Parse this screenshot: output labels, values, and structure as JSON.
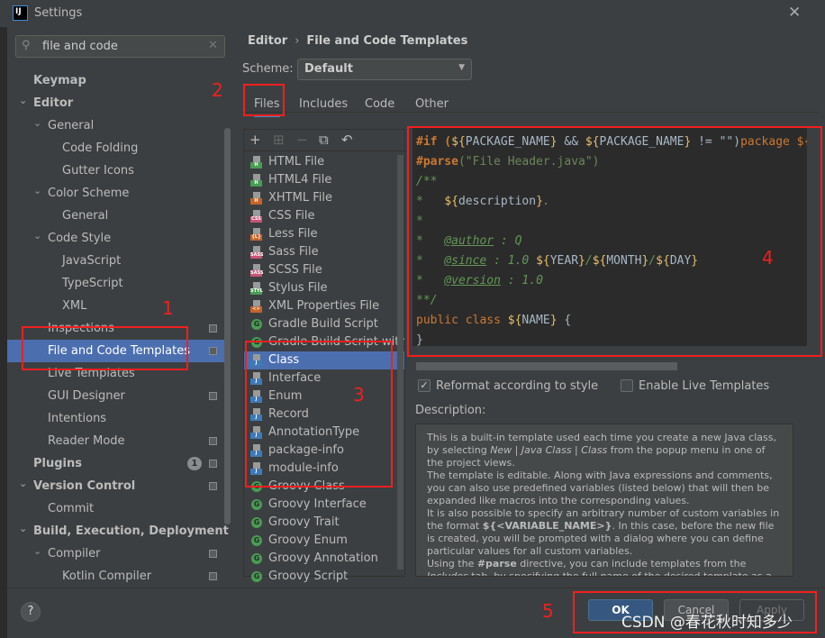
{
  "window": {
    "title": "Settings",
    "logo": "IJ",
    "close_icon": "close-icon"
  },
  "sidebar": {
    "search_value": "file and code",
    "items": [
      {
        "label": "Keymap",
        "level": 0,
        "bold": true
      },
      {
        "label": "Editor",
        "level": 0,
        "bold": true,
        "expanded": true
      },
      {
        "label": "General",
        "level": 1,
        "expanded": true
      },
      {
        "label": "Code Folding",
        "level": 2
      },
      {
        "label": "Gutter Icons",
        "level": 2
      },
      {
        "label": "Color Scheme",
        "level": 1,
        "expanded": true
      },
      {
        "label": "General",
        "level": 2
      },
      {
        "label": "Code Style",
        "level": 1,
        "expanded": true
      },
      {
        "label": "JavaScript",
        "level": 2
      },
      {
        "label": "TypeScript",
        "level": 2
      },
      {
        "label": "XML",
        "level": 2
      },
      {
        "label": "Inspections",
        "level": 1,
        "gear": true
      },
      {
        "label": "File and Code Templates",
        "level": 1,
        "selected": true,
        "gear": true
      },
      {
        "label": "Live Templates",
        "level": 1
      },
      {
        "label": "GUI Designer",
        "level": 1,
        "gear": true
      },
      {
        "label": "Intentions",
        "level": 1
      },
      {
        "label": "Reader Mode",
        "level": 1,
        "gear": true
      },
      {
        "label": "Plugins",
        "level": 0,
        "bold": true,
        "badge": "1",
        "gear": true
      },
      {
        "label": "Version Control",
        "level": 0,
        "bold": true,
        "expanded": true,
        "gear": true
      },
      {
        "label": "Commit",
        "level": 1
      },
      {
        "label": "Build, Execution, Deployment",
        "level": 0,
        "bold": true,
        "expanded": true
      },
      {
        "label": "Compiler",
        "level": 1,
        "expanded": true,
        "gear": true
      },
      {
        "label": "Kotlin Compiler",
        "level": 2,
        "gear": true
      }
    ]
  },
  "main": {
    "breadcrumb": [
      "Editor",
      "File and Code Templates"
    ],
    "scheme_label": "Scheme:",
    "scheme_value": "Default",
    "tabs": [
      {
        "label": "Files",
        "active": true
      },
      {
        "label": "Includes"
      },
      {
        "label": "Code"
      },
      {
        "label": "Other"
      }
    ],
    "templates": [
      {
        "label": "HTML File",
        "icon": "H",
        "color": "#499c54"
      },
      {
        "label": "HTML4 File",
        "icon": "H",
        "color": "#499c54"
      },
      {
        "label": "XHTML File",
        "icon": "H",
        "color": "#c5642a"
      },
      {
        "label": "CSS File",
        "icon": "CSS",
        "color": "#c75476"
      },
      {
        "label": "Less File",
        "icon": "{L}",
        "color": "#c5642a"
      },
      {
        "label": "Sass File",
        "icon": "SASS",
        "color": "#c75476"
      },
      {
        "label": "SCSS File",
        "icon": "SASS",
        "color": "#c75476"
      },
      {
        "label": "Stylus File",
        "icon": "STYL",
        "color": "#499c54"
      },
      {
        "label": "XML Properties File",
        "icon": "<>",
        "color": "#c5642a"
      },
      {
        "label": "Gradle Build Script",
        "icon": "G",
        "type": "gradle"
      },
      {
        "label": "Gradle Build Script with wrapper",
        "icon": "G",
        "type": "gradle"
      },
      {
        "label": "Class",
        "icon": "J",
        "color": "#3d7ab8",
        "selected": true
      },
      {
        "label": "Interface",
        "icon": "J",
        "color": "#3d7ab8"
      },
      {
        "label": "Enum",
        "icon": "J",
        "color": "#3d7ab8"
      },
      {
        "label": "Record",
        "icon": "J",
        "color": "#3d7ab8"
      },
      {
        "label": "AnnotationType",
        "icon": "J",
        "color": "#3d7ab8"
      },
      {
        "label": "package-info",
        "icon": "J",
        "color": "#3d7ab8"
      },
      {
        "label": "module-info",
        "icon": "J",
        "color": "#3d7ab8"
      },
      {
        "label": "Groovy Class",
        "icon": "G",
        "type": "gradle"
      },
      {
        "label": "Groovy Interface",
        "icon": "G",
        "type": "gradle"
      },
      {
        "label": "Groovy Trait",
        "icon": "G",
        "type": "gradle"
      },
      {
        "label": "Groovy Enum",
        "icon": "G",
        "type": "gradle"
      },
      {
        "label": "Groovy Annotation",
        "icon": "G",
        "type": "gradle"
      },
      {
        "label": "Groovy Script",
        "icon": "G",
        "type": "gradle"
      }
    ],
    "code_lines": [
      [
        [
          "#if (",
          "#cc7832"
        ],
        [
          "${",
          "#e8bf6a"
        ],
        [
          "PACKAGE_NAME",
          "#a9b7c6"
        ],
        [
          "}",
          "#e8bf6a"
        ],
        [
          " && ",
          "#a9b7c6"
        ],
        [
          "${",
          "#e8bf6a"
        ],
        [
          "PACKAGE_NAME",
          "#a9b7c6"
        ],
        [
          "}",
          "#e8bf6a"
        ],
        [
          " != \"\")",
          "#a9b7c6"
        ],
        [
          "package ${",
          "#cc7832"
        ]
      ],
      [
        [
          "#parse",
          "#cc7832"
        ],
        [
          "(\"File Header.java\")",
          "#6a8759"
        ]
      ],
      [
        [
          "/**",
          "#629755"
        ]
      ],
      [
        [
          "*   ",
          "#629755"
        ],
        [
          "${",
          "#e8bf6a"
        ],
        [
          "description",
          "#a9b7c6"
        ],
        [
          "}",
          "#e8bf6a"
        ],
        [
          ".",
          "#629755"
        ]
      ],
      [
        [
          "*",
          "#629755"
        ]
      ],
      [
        [
          "*   ",
          "#629755"
        ],
        [
          "@author",
          "#629755"
        ],
        [
          " : Q",
          "#629755"
        ]
      ],
      [
        [
          "*   ",
          "#629755"
        ],
        [
          "@since",
          "#629755"
        ],
        [
          " : 1.0 ",
          "#629755"
        ],
        [
          "${",
          "#e8bf6a"
        ],
        [
          "YEAR",
          "#a9b7c6"
        ],
        [
          "}",
          "#e8bf6a"
        ],
        [
          "/",
          "#629755"
        ],
        [
          "${",
          "#e8bf6a"
        ],
        [
          "MONTH",
          "#a9b7c6"
        ],
        [
          "}",
          "#e8bf6a"
        ],
        [
          "/",
          "#629755"
        ],
        [
          "${",
          "#e8bf6a"
        ],
        [
          "DAY",
          "#a9b7c6"
        ],
        [
          "}",
          "#e8bf6a"
        ]
      ],
      [
        [
          "*   ",
          "#629755"
        ],
        [
          "@version",
          "#629755"
        ],
        [
          " : 1.0",
          "#629755"
        ]
      ],
      [
        [
          "**/",
          "#629755"
        ]
      ],
      [
        [
          "public class ",
          "#cc7832"
        ],
        [
          "${",
          "#e8bf6a"
        ],
        [
          "NAME",
          "#a9b7c6"
        ],
        [
          "}",
          "#e8bf6a"
        ],
        [
          " {",
          "#a9b7c6"
        ]
      ],
      [
        [
          "}",
          "#a9b7c6"
        ]
      ]
    ],
    "reformat_label": "Reformat according to style",
    "reformat_checked": true,
    "live_label": "Enable Live Templates",
    "live_checked": false,
    "description_label": "Description:",
    "description_html": "This is a built-in template used each time you create a new Java class, by selecting <i>New</i> | <i>Java Class</i> | <i>Class</i> from the popup menu in one of the project views.<br>The template is editable. Along with Java expressions and comments, you can also use predefined variables (listed below) that will then be expanded like macros into the corresponding values.<br>It is also possible to specify an arbitrary number of custom variables in the format <b>${&lt;VARIABLE_NAME&gt;}</b>. In this case, before the new file is created, you will be prompted with a dialog where you can define particular values for all custom variables.<br>Using the <b>#parse</b> directive, you can include templates from the <i>Includes</i> tab, by specifying the full name of the desired template as a"
  },
  "footer": {
    "help": "?",
    "ok": "OK",
    "cancel": "Cancel",
    "apply": "Apply"
  },
  "annotations": [
    "1",
    "2",
    "3",
    "4",
    "5"
  ],
  "watermark": "CSDN @春花秋时知多少",
  "colors": {
    "selection": "#4b6eaf",
    "annotation": "#f21f1f",
    "background": "#3c3f41",
    "editor": "#2b2b2b"
  }
}
